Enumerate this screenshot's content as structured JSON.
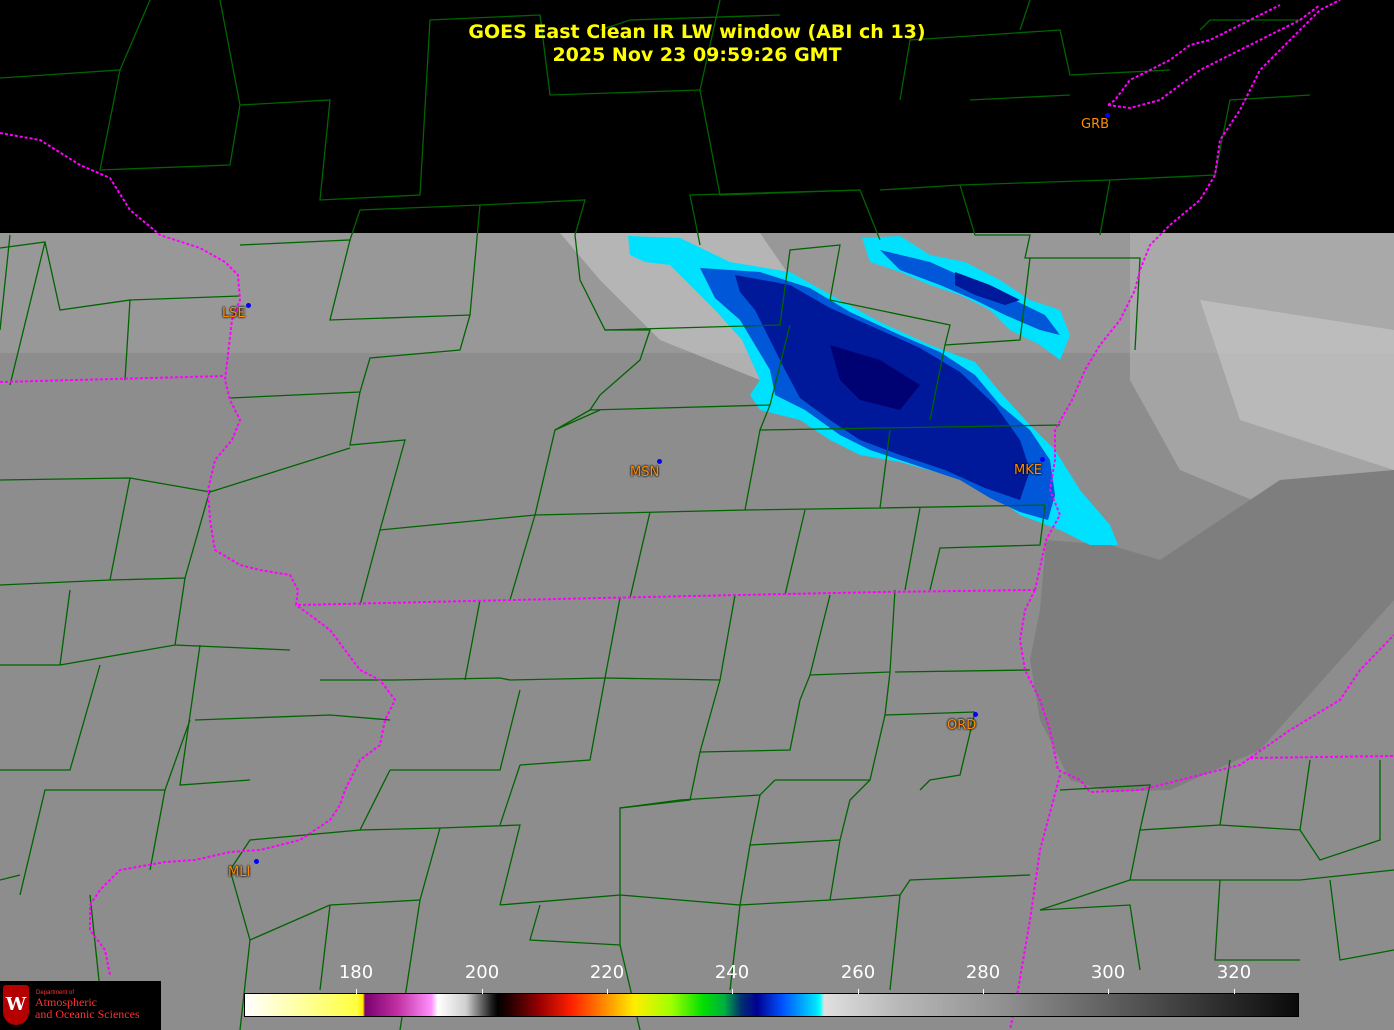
{
  "title": {
    "line1": "GOES East Clean IR LW window (ABI ch 13)",
    "line2": "2025 Nov 23  09:59:26 GMT"
  },
  "stations": [
    {
      "id": "LSE",
      "label": "LSE"
    },
    {
      "id": "GRB",
      "label": "GRB"
    },
    {
      "id": "MSN",
      "label": "MSN"
    },
    {
      "id": "MKE",
      "label": "MKE"
    },
    {
      "id": "ORD",
      "label": "ORD"
    },
    {
      "id": "MLI",
      "label": "MLI"
    }
  ],
  "colorbar": {
    "ticks": [
      "180",
      "200",
      "220",
      "240",
      "260",
      "280",
      "300",
      "320"
    ],
    "label_color": "#ffffff"
  },
  "logo": {
    "small": "Department of",
    "line1": "Atmospheric",
    "line2": "and Oceanic Sciences"
  },
  "colors": {
    "title": "#ffff00",
    "county_lines": "#006400",
    "state_lines": "#ff00ff",
    "station_label": "#ff8c00",
    "station_dot": "#0000ff",
    "cloud_cold": "#000090",
    "cloud_edge": "#00e5ff"
  }
}
